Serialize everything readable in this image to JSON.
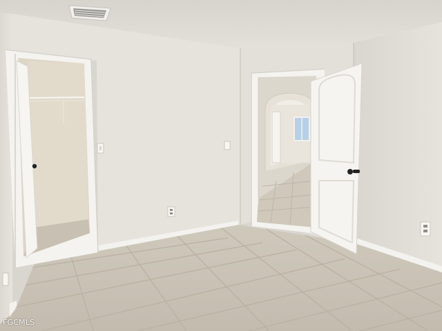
{
  "photo": {
    "subject": "empty-bedroom-interior",
    "watermark": "FGCMLS"
  },
  "colors": {
    "ceiling": "#dedbd5",
    "wall_left": "#e4e1db",
    "wall_back": "#e8e5df",
    "wall_right": "#e1ded8",
    "floor_tile": "#c9c2b5",
    "grout": "#b7af9f",
    "trim": "#f4f3ef",
    "door": "#f5f4f0",
    "closet_interior": "#ddd6c6",
    "hallway_floor": "#cfc8bb",
    "window": "#b8d0e6",
    "vent": "#9b9a96",
    "hardware": "#222222"
  },
  "icons": [
    "ceiling-vent-icon",
    "light-switch-icon",
    "outlet-icon",
    "door-knob-icon",
    "closet-rod-icon"
  ]
}
